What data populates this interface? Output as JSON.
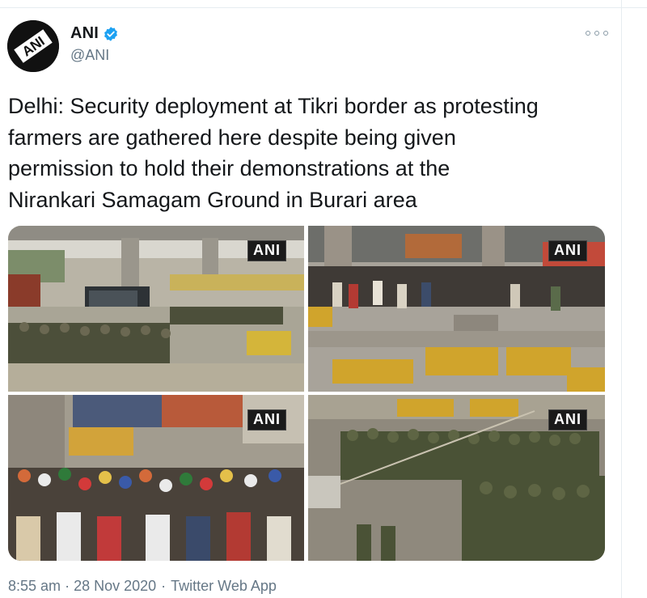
{
  "author": {
    "name": "ANI",
    "handle": "@ANI",
    "avatar_text": "ANI"
  },
  "icons": {
    "verified": "verified-badge-icon",
    "more": "more-options-icon"
  },
  "tweet": {
    "text": "Delhi: Security deployment at Tikri border as protesting\nfarmers are gathered here despite being given\npermission to hold their demonstrations at the\nNirankari Samagam Ground in Burari area"
  },
  "media": {
    "watermark": "ANI",
    "photo_count": 4
  },
  "meta": {
    "time": "8:55 am",
    "separator": "·",
    "date": "28 Nov 2020",
    "source": "Twitter Web App"
  },
  "colors": {
    "verified_blue": "#1da1f2",
    "secondary_text": "#657786",
    "primary_text": "#14171a"
  }
}
